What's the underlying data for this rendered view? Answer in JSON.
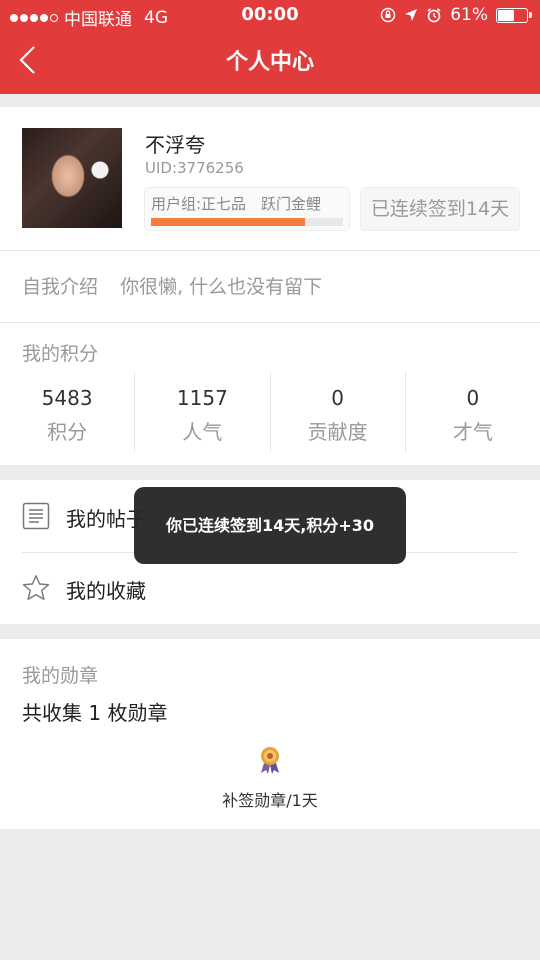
{
  "status_bar": {
    "carrier": "中国联通",
    "network": "4G",
    "time": "00:00",
    "battery": "61%",
    "battery_level": 0.61
  },
  "header": {
    "title": "个人中心"
  },
  "profile": {
    "username": "不浮夸",
    "uid": "UID:3776256",
    "group": "用户组:正七品　跃门金鲤",
    "level_progress": 0.8,
    "checkin": "已连续签到14天"
  },
  "intro": {
    "label": "自我介绍",
    "text": "你很懒, 什么也没有留下"
  },
  "points": {
    "title": "我的积分",
    "stats": [
      {
        "value": "5483",
        "label": "积分"
      },
      {
        "value": "1157",
        "label": "人气"
      },
      {
        "value": "0",
        "label": "贡献度"
      },
      {
        "value": "0",
        "label": "才气"
      }
    ]
  },
  "menu": {
    "posts": "我的帖子",
    "favorites": "我的收藏"
  },
  "medals": {
    "title": "我的勋章",
    "count_text": "共收集 1 枚勋章",
    "medal_name": "补签勋章/1天"
  },
  "toast": "你已连续签到14天,积分+30",
  "colors": {
    "header": "#e23b3c",
    "progress": "#f47c3c"
  }
}
